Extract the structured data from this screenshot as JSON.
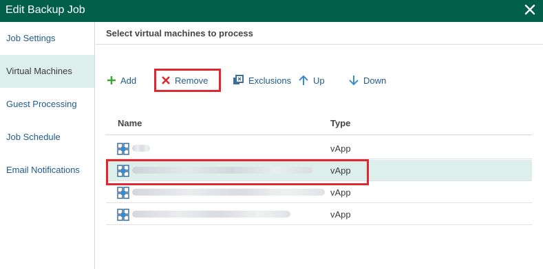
{
  "window": {
    "title": "Edit Backup Job"
  },
  "sidebar": {
    "items": [
      {
        "label": "Job Settings"
      },
      {
        "label": "Virtual Machines",
        "active": true
      },
      {
        "label": "Guest Processing"
      },
      {
        "label": "Job Schedule"
      },
      {
        "label": "Email Notifications"
      }
    ]
  },
  "main": {
    "heading": "Select virtual machines to process",
    "toolbar": {
      "add": "Add",
      "remove": "Remove",
      "exclusions": "Exclusions",
      "up": "Up",
      "down": "Down"
    },
    "table": {
      "columns": [
        "Name",
        "Type"
      ],
      "rows": [
        {
          "type": "vApp",
          "selected": false
        },
        {
          "type": "vApp",
          "selected": true
        },
        {
          "type": "vApp",
          "selected": false
        },
        {
          "type": "vApp",
          "selected": false
        }
      ]
    }
  },
  "colors": {
    "titlebar": "#005f4b",
    "selection": "#dcefeb",
    "link": "#1e5a8c",
    "highlight_border": "#e0262e",
    "add_icon": "#3fa535",
    "remove_icon": "#e0262e"
  },
  "icons": {
    "add": "plus-icon",
    "remove": "x-icon",
    "exclusions": "exclusions-icon",
    "up": "arrow-up-icon",
    "down": "arrow-down-icon",
    "vm": "vapp-icon"
  }
}
